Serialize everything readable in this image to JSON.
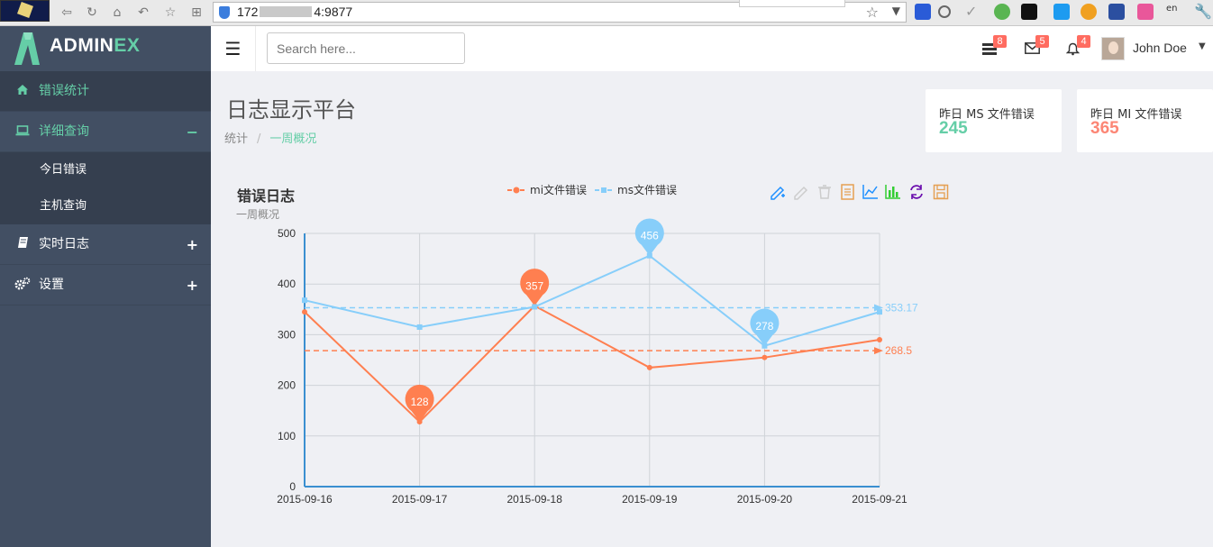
{
  "browser": {
    "url_prefix": "172",
    "url_suffix": "4:9877"
  },
  "brand": {
    "name_a": "ADMIN",
    "name_b": "EX"
  },
  "sidebar": {
    "items": [
      {
        "label": "错误统计",
        "icon": "home-icon",
        "control": ""
      },
      {
        "label": "详细查询",
        "icon": "laptop-icon",
        "control": "−"
      },
      {
        "label": "实时日志",
        "icon": "book-icon",
        "control": "+"
      },
      {
        "label": "设置",
        "icon": "cogs-icon",
        "control": "+"
      }
    ],
    "submenu": [
      {
        "label": "今日错误"
      },
      {
        "label": "主机查询"
      }
    ]
  },
  "header": {
    "search_placeholder": "Search here...",
    "notifications": [
      {
        "icon": "tasks-icon",
        "count": "8"
      },
      {
        "icon": "envelope-icon",
        "count": "5"
      },
      {
        "icon": "bell-icon",
        "count": "4"
      }
    ],
    "user_name": "John Doe"
  },
  "page": {
    "title": "日志显示平台",
    "breadcrumb": [
      "统计",
      "一周概况"
    ]
  },
  "stats": [
    {
      "label": "昨日 MS 文件错误",
      "value": "245",
      "color": "#65cea7"
    },
    {
      "label": "昨日 MI 文件错误",
      "value": "365",
      "color": "#fc8675"
    }
  ],
  "chart_data": {
    "type": "line",
    "title": "错误日志",
    "subtitle": "一周概况",
    "categories": [
      "2015-09-16",
      "2015-09-17",
      "2015-09-18",
      "2015-09-19",
      "2015-09-20",
      "2015-09-21"
    ],
    "ylim": [
      0,
      500
    ],
    "yticks": [
      0,
      100,
      200,
      300,
      400,
      500
    ],
    "grid": true,
    "legend_placement": "top-center",
    "series": [
      {
        "name": "mi文件错误",
        "color": "#ff7f50",
        "values": [
          345,
          128,
          357,
          235,
          255,
          290
        ],
        "pins": [
          {
            "index": 1,
            "label": "128"
          },
          {
            "index": 2,
            "label": "357"
          }
        ],
        "average": 268.5,
        "average_label": "268.5"
      },
      {
        "name": "ms文件错误",
        "color": "#87cefa",
        "values": [
          368,
          315,
          355,
          456,
          278,
          345
        ],
        "pins": [
          {
            "index": 3,
            "label": "456"
          },
          {
            "index": 4,
            "label": "278"
          }
        ],
        "average": 353.17,
        "average_label": "353.17"
      }
    ]
  },
  "toolbox": [
    {
      "icon": "mark-pen-icon",
      "color": "#1e90ff"
    },
    {
      "icon": "mark-undo-icon",
      "color": "#cccccc"
    },
    {
      "icon": "mark-clear-icon",
      "color": "#cccccc"
    },
    {
      "icon": "data-view-icon",
      "color": "#e5a053"
    },
    {
      "icon": "line-chart-icon",
      "color": "#1e90ff"
    },
    {
      "icon": "bar-chart-icon",
      "color": "#32cd32"
    },
    {
      "icon": "restore-icon",
      "color": "#6a0dad"
    },
    {
      "icon": "save-image-icon",
      "color": "#e5a053"
    }
  ]
}
